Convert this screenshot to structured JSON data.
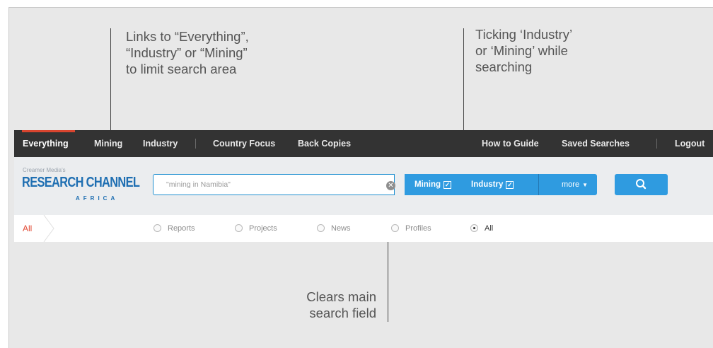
{
  "annotations": {
    "nav_links_note": "Links to “Everything”,\n“Industry” or “Mining”\nto limit search area",
    "ticking_note": "Ticking ‘Industry’\nor ‘Mining’ while\nsearching",
    "clear_note": "Clears main\nsearch field"
  },
  "nav": {
    "everything": "Everything",
    "mining": "Mining",
    "industry": "Industry",
    "country_focus": "Country Focus",
    "back_copies": "Back Copies",
    "how_to_guide": "How to Guide",
    "saved_searches": "Saved Searches",
    "logout": "Logout",
    "active": "Everything"
  },
  "logo": {
    "small": "Creamer Media's",
    "main": "RESEARCH CHANNEL",
    "sub": "AFRICA"
  },
  "search": {
    "value": "\"mining in Namibia\"",
    "clear_icon": "clear-icon",
    "search_icon": "search-icon"
  },
  "filters": {
    "mining": {
      "label": "Mining",
      "checked": true
    },
    "industry": {
      "label": "Industry",
      "checked": true
    },
    "more_label": "more"
  },
  "result_types": {
    "breadcrumb": "All",
    "options": [
      "Reports",
      "Projects",
      "News",
      "Profiles",
      "All"
    ],
    "selected": "All"
  },
  "colors": {
    "nav_bg": "#333333",
    "nav_accent": "#d9452f",
    "brand_blue": "#1f6fb2",
    "button_blue": "#2f9be0",
    "breadcrumb_red": "#e24b36",
    "annotation_text": "#555555"
  }
}
